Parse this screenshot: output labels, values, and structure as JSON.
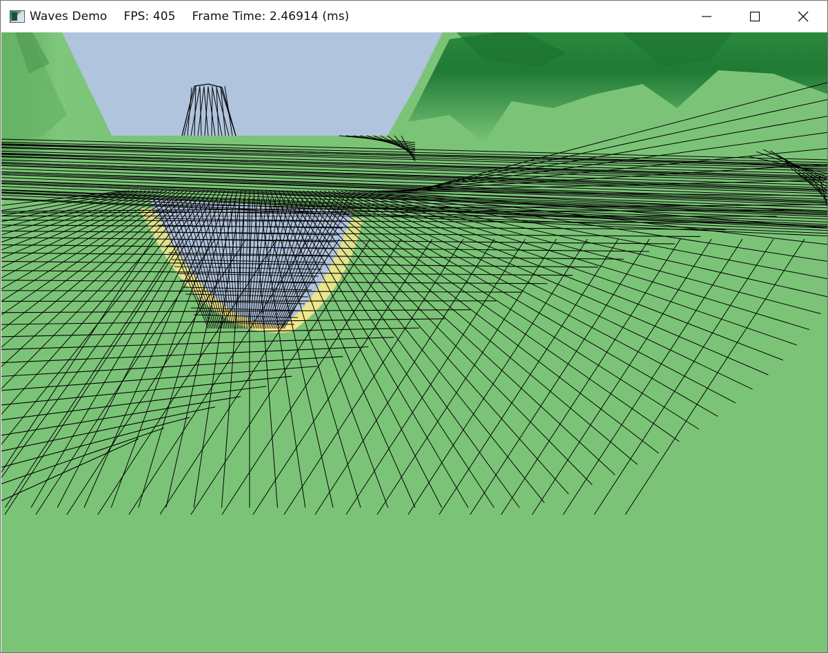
{
  "window": {
    "app_name": "Waves Demo",
    "fps_text": "FPS: 405",
    "frame_time_text": "Frame Time: 2.46914 (ms)"
  },
  "scene": {
    "sky_color": "#b0c4de",
    "ground_color": "#7bc477",
    "hill_dark_color": "#1f7a34",
    "sand_color": "#f1e58a",
    "wireframe_color": "#000000"
  },
  "icons": {
    "app": "app-icon",
    "minimize": "minimize-icon",
    "maximize": "maximize-icon",
    "close": "close-icon"
  }
}
